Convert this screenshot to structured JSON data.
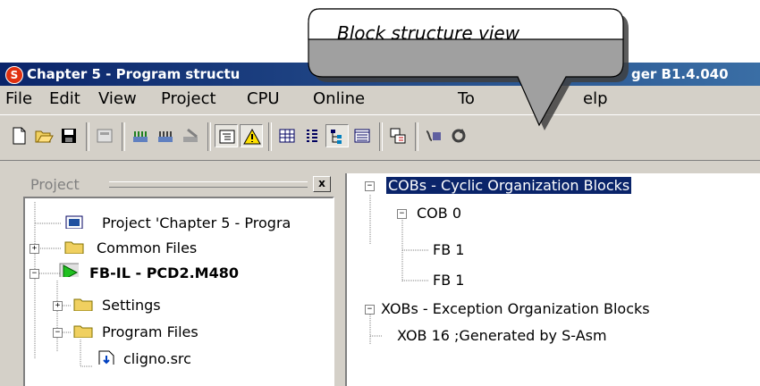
{
  "window": {
    "title_left": "Chapter 5 - Program structu",
    "title_right": "ger B1.4.040"
  },
  "menu": [
    "File",
    "Edit",
    "View",
    "Project",
    "CPU",
    "Online",
    "To",
    "elp"
  ],
  "callout": {
    "text": "Block structure view"
  },
  "toolbar": {
    "buttons": [
      "new-file-icon",
      "open-folder-icon",
      "save-icon",
      "properties-icon",
      "build-icon",
      "build-all-icon",
      "delete-icon",
      "tree-view-icon",
      "warning-icon",
      "grid-view-icon",
      "list-view-icon",
      "block-structure-icon",
      "columns-view-icon",
      "download-icon",
      "online-icon",
      "refresh-icon"
    ]
  },
  "left_pane": {
    "header": "Project",
    "close": "x",
    "tree": [
      {
        "label": "Project 'Chapter 5 - Progra",
        "icon": "project-icon"
      },
      {
        "label": "Common Files",
        "icon": "folder-icon"
      },
      {
        "label": "FB-IL - PCD2.M480",
        "icon": "cpu-run-icon"
      },
      {
        "label": "Settings",
        "icon": "folder-icon"
      },
      {
        "label": "Program Files",
        "icon": "folder-icon"
      },
      {
        "label": "cligno.src",
        "icon": "source-file-icon"
      }
    ]
  },
  "right_pane": {
    "tree": [
      {
        "label": "COBs - Cyclic Organization Blocks",
        "selected": true
      },
      {
        "label": "COB 0"
      },
      {
        "label": "FB 1"
      },
      {
        "label": "FB 1"
      },
      {
        "label": "XOBs - Exception Organization Blocks"
      },
      {
        "label": "XOB 16  ;Generated by S-Asm"
      }
    ]
  },
  "colors": {
    "titlebar": "#0a246a",
    "selection": "#0a246a",
    "chrome": "#d4d0c8"
  }
}
